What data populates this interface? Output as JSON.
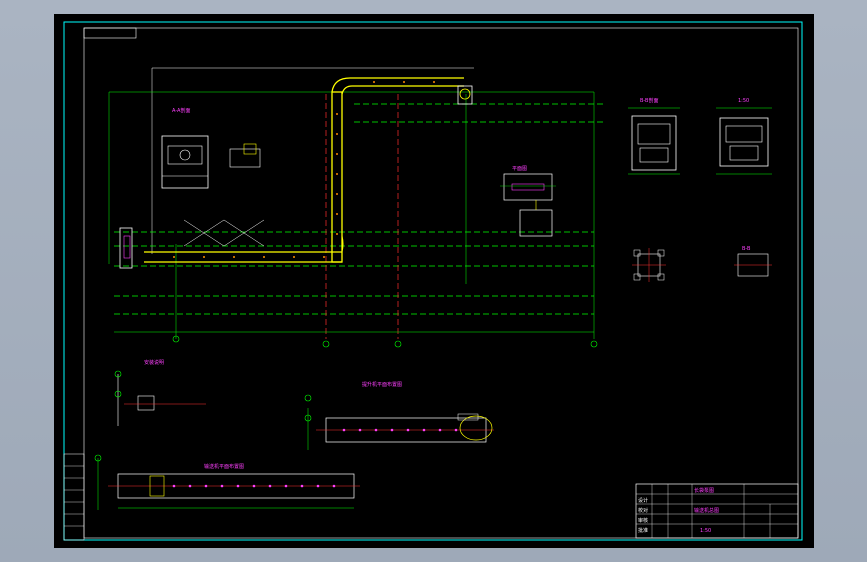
{
  "colors": {
    "background": "#000000",
    "border": "#00ffff",
    "dim_line": "#00ff00",
    "center_line": "#00ff00",
    "conveyor": "#ffff00",
    "text": "#ff40ff",
    "detail": "#ffffff",
    "chrome": "#9ea9b8"
  },
  "labels": {
    "section_a": "A-A剖面",
    "section_b": "B-B剖面",
    "detail_1": "1:50",
    "detail_2": "B-B",
    "plan_view": "平面图",
    "left_note": "安装说明",
    "lower_title": "提升机平面布置图",
    "bottom_title": "输送机平面布置图",
    "title_block_name": "长袋泵图",
    "title_block_sub": "输送机总图",
    "title_block_scale": "1:50"
  },
  "title_block": {
    "rows": [
      "设计",
      "校对",
      "审核",
      "批准"
    ]
  }
}
